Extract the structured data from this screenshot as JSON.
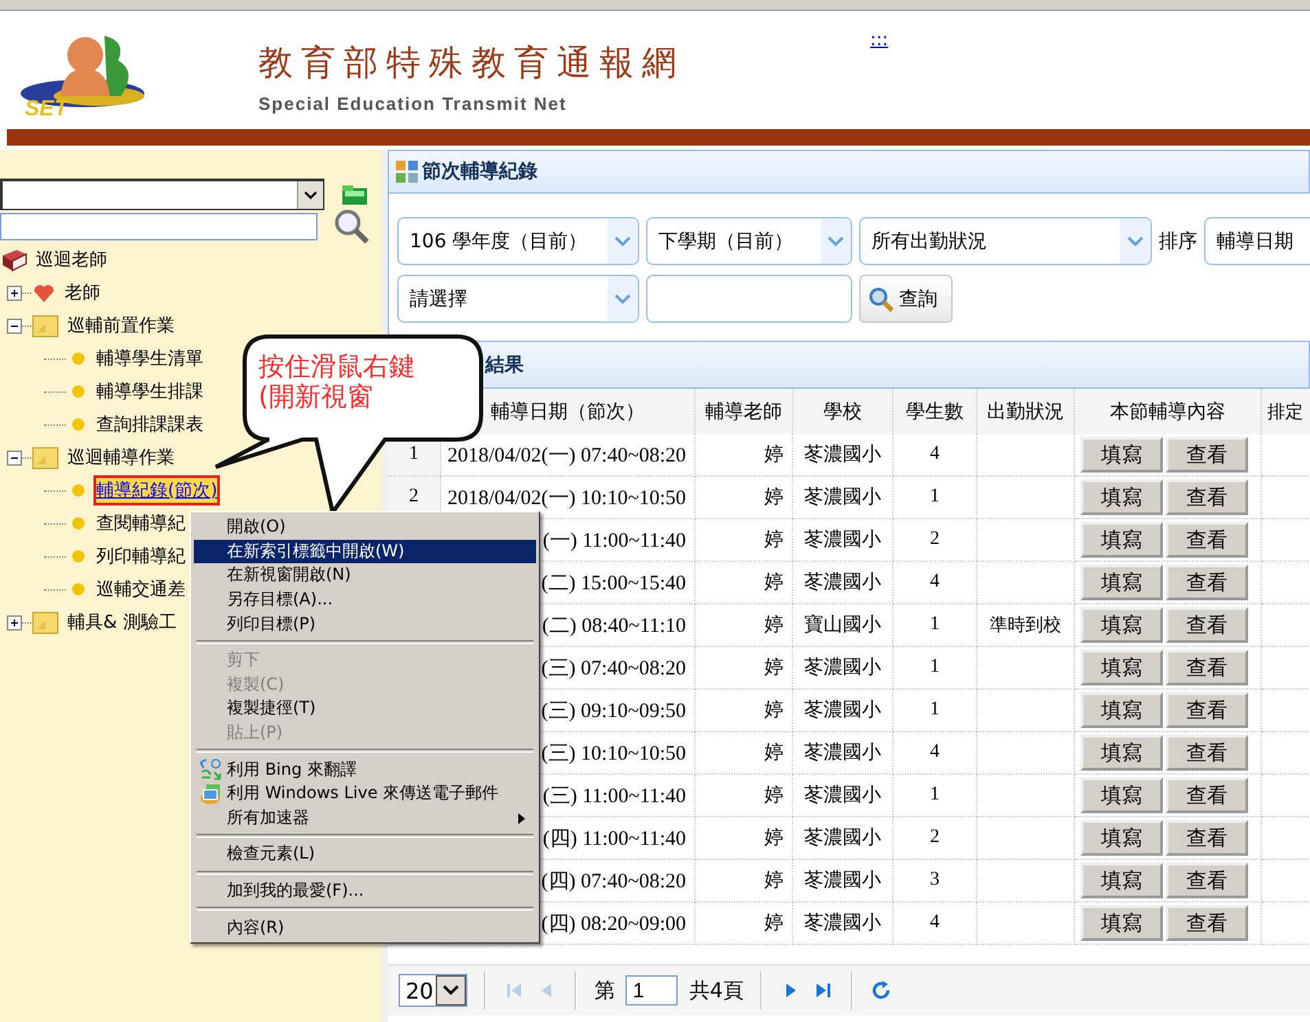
{
  "header": {
    "logo_text": "SET",
    "title": "教育部特殊教育通報網",
    "subtitle": "Special Education Transmit Net",
    "link": ":::"
  },
  "sidebar": {
    "tree": [
      {
        "label": "巡迴老師",
        "kind": "book",
        "children": [
          {
            "label": "老師",
            "kind": "heart",
            "expanded": false
          },
          {
            "label": "巡輔前置作業",
            "kind": "folder",
            "expanded": true,
            "children": [
              {
                "label": "輔導學生清單",
                "kind": "leaf",
                "selected": false
              },
              {
                "label": "輔導學生排課",
                "kind": "leaf",
                "selected": false
              },
              {
                "label": "查詢排課課表",
                "kind": "leaf",
                "selected": false
              }
            ]
          },
          {
            "label": "巡迴輔導作業",
            "kind": "folder",
            "expanded": true,
            "children": [
              {
                "label": "輔導紀錄(節次)",
                "kind": "leaf",
                "selected": true
              },
              {
                "label": "查閱輔導紀",
                "kind": "leaf",
                "selected": false
              },
              {
                "label": "列印輔導紀",
                "kind": "leaf",
                "selected": false
              },
              {
                "label": "巡輔交通差",
                "kind": "leaf",
                "selected": false
              }
            ]
          },
          {
            "label": "輔具& 測驗工",
            "kind": "folder",
            "expanded": false
          }
        ]
      }
    ]
  },
  "callout": {
    "lines": [
      "按住滑鼠右鍵",
      "(開新視窗"
    ]
  },
  "context_menu": {
    "items": [
      {
        "kind": "item",
        "label": "開啟(O)",
        "selected": false,
        "disabled": false
      },
      {
        "kind": "item",
        "label": "在新索引標籤中開啟(W)",
        "selected": true,
        "disabled": false
      },
      {
        "kind": "item",
        "label": "在新視窗開啟(N)",
        "selected": false,
        "disabled": false
      },
      {
        "kind": "item",
        "label": "另存目標(A)...",
        "selected": false,
        "disabled": false
      },
      {
        "kind": "item",
        "label": "列印目標(P)",
        "selected": false,
        "disabled": false
      },
      {
        "kind": "separator"
      },
      {
        "kind": "item",
        "label": "剪下",
        "selected": false,
        "disabled": true
      },
      {
        "kind": "item",
        "label": "複製(C)",
        "selected": false,
        "disabled": true
      },
      {
        "kind": "item",
        "label": "複製捷徑(T)",
        "selected": false,
        "disabled": false
      },
      {
        "kind": "item",
        "label": "貼上(P)",
        "selected": false,
        "disabled": true
      },
      {
        "kind": "separator"
      },
      {
        "kind": "item",
        "label": "利用 Bing 來翻譯",
        "selected": false,
        "disabled": false,
        "has_icon": true
      },
      {
        "kind": "item",
        "label": "利用 Windows Live 來傳送電子郵件",
        "selected": false,
        "disabled": false,
        "has_icon": true
      },
      {
        "kind": "item",
        "label": "所有加速器",
        "selected": false,
        "disabled": false,
        "submenu": true
      },
      {
        "kind": "separator"
      },
      {
        "kind": "item",
        "label": "檢查元素(L)",
        "selected": false,
        "disabled": false
      },
      {
        "kind": "separator"
      },
      {
        "kind": "item",
        "label": "加到我的最愛(F)...",
        "selected": false,
        "disabled": false
      },
      {
        "kind": "separator"
      },
      {
        "kind": "item",
        "label": "內容(R)",
        "selected": false,
        "disabled": false
      }
    ]
  },
  "panel": {
    "title": "節次輔導紀錄",
    "filter_rows": [
      [
        {
          "kind": "select",
          "value": "106 學年度（目前）"
        },
        {
          "kind": "select",
          "value": "下學期（目前）"
        },
        {
          "kind": "select",
          "value": "所有出勤狀況"
        },
        {
          "kind": "label",
          "value": "排序"
        },
        {
          "kind": "select",
          "value": "輔導日期"
        }
      ],
      [
        {
          "kind": "select",
          "value": "請選擇"
        },
        {
          "kind": "input"
        },
        {
          "kind": "button",
          "value": "查詢"
        }
      ]
    ]
  },
  "results": {
    "title": "結果",
    "columns": [
      "輔導日期（節次）",
      "輔導老師",
      "學校",
      "學生數",
      "出勤狀況",
      "本節輔導內容",
      "排定"
    ],
    "rows": [
      {
        "number": "1",
        "date": "2018/04/02(一) 07:40~08:20",
        "teacher": "婷",
        "school": "苳濃國小",
        "students": "4",
        "buttons": [
          "填寫",
          "查看"
        ]
      },
      {
        "number": "2",
        "date": "2018/04/02(一) 10:10~10:50",
        "teacher": "婷",
        "school": "苳濃國小",
        "students": "1",
        "buttons": [
          "填寫",
          "查看"
        ]
      },
      {
        "date": "(一) 11:00~11:40",
        "teacher": "婷",
        "school": "苳濃國小",
        "students": "2",
        "buttons": [
          "填寫",
          "查看"
        ]
      },
      {
        "date": "(二) 15:00~15:40",
        "teacher": "婷",
        "school": "苳濃國小",
        "students": "4",
        "buttons": [
          "填寫",
          "查看"
        ]
      },
      {
        "date": "(二) 08:40~11:10",
        "teacher": "婷",
        "school": "寶山國小",
        "students": "1",
        "attendance": "準時到校",
        "buttons": [
          "填寫",
          "查看"
        ]
      },
      {
        "date": "(三) 07:40~08:20",
        "teacher": "婷",
        "school": "苳濃國小",
        "students": "1",
        "buttons": [
          "填寫",
          "查看"
        ]
      },
      {
        "date": "(三) 09:10~09:50",
        "teacher": "婷",
        "school": "苳濃國小",
        "students": "1",
        "buttons": [
          "填寫",
          "查看"
        ]
      },
      {
        "date": "(三) 10:10~10:50",
        "teacher": "婷",
        "school": "苳濃國小",
        "students": "4",
        "buttons": [
          "填寫",
          "查看"
        ]
      },
      {
        "date": "(三) 11:00~11:40",
        "teacher": "婷",
        "school": "苳濃國小",
        "students": "1",
        "buttons": [
          "填寫",
          "查看"
        ]
      },
      {
        "date": "(四) 11:00~11:40",
        "teacher": "婷",
        "school": "苳濃國小",
        "students": "2",
        "buttons": [
          "填寫",
          "查看"
        ]
      },
      {
        "date": "(四) 07:40~08:20",
        "teacher": "婷",
        "school": "苳濃國小",
        "students": "3",
        "buttons": [
          "填寫",
          "查看"
        ]
      },
      {
        "date": "(四) 08:20~09:00",
        "teacher": "婷",
        "school": "苳濃國小",
        "students": "4",
        "buttons": [
          "填寫",
          "查看"
        ]
      }
    ]
  },
  "pager": {
    "page_size": "20",
    "page_label": "第",
    "page": "1",
    "total": "共4頁"
  }
}
